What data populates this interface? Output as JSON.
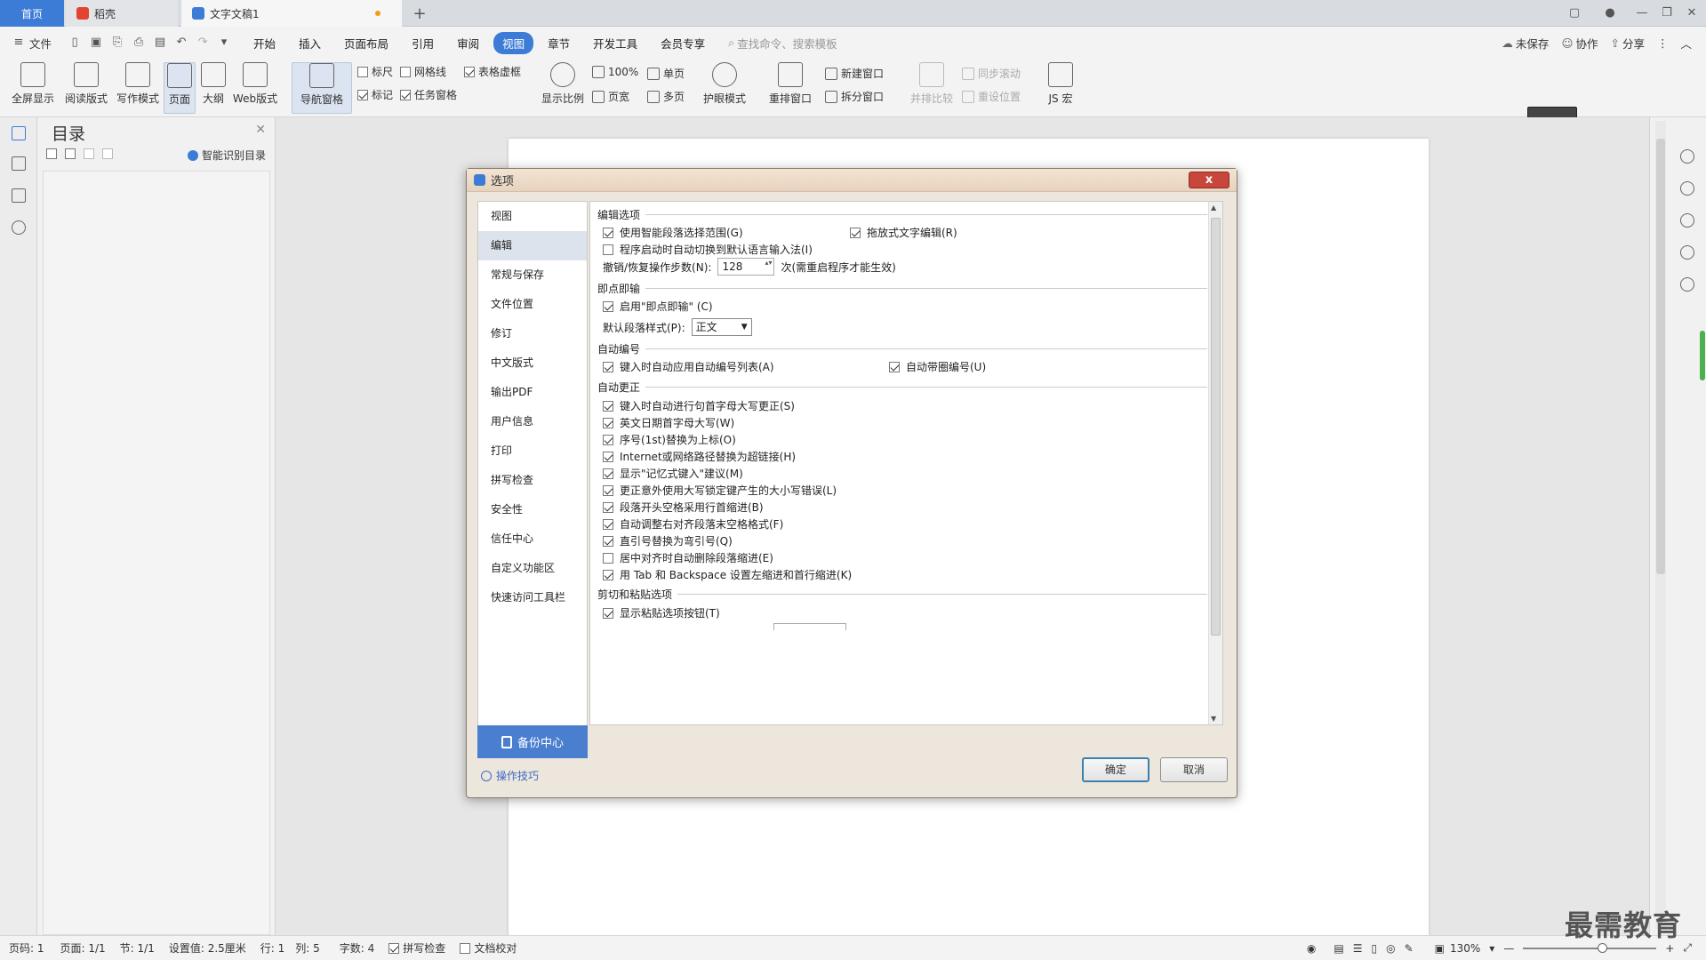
{
  "tabs": {
    "home": "首页",
    "daoke": "稻壳",
    "document": "文字文稿1",
    "new_tab": "+"
  },
  "menubar": {
    "file": "文件",
    "items": [
      "开始",
      "插入",
      "页面布局",
      "引用",
      "审阅",
      "视图",
      "章节",
      "开发工具",
      "会员专享"
    ],
    "active": "视图",
    "search_placeholder": "查找命令、搜索模板",
    "unsaved": "未保存",
    "collab": "协作",
    "share": "分享"
  },
  "ribbon": {
    "fullscreen": "全屏显示",
    "reading": "阅读版式",
    "writing": "写作模式",
    "page": "页面",
    "outline": "大纲",
    "web": "Web版式",
    "nav_pane": "导航窗格",
    "ruler": "标尺",
    "gridlines": "网格线",
    "table_gridlines": "表格虚框",
    "marks": "标记",
    "task_pane": "任务窗格",
    "zoom": "显示比例",
    "zoom_100": "100%",
    "single_page": "单页",
    "page_width": "页宽",
    "multi_page": "多页",
    "eye_mode": "护眼模式",
    "arrange_window": "重排窗口",
    "new_window": "新建窗口",
    "split_window": "拆分窗口",
    "side_by_side": "并排比较",
    "sync_scroll": "同步滚动",
    "reset_position": "重设位置",
    "js_macro": "JS 宏"
  },
  "left_panel": {
    "title": "目录",
    "smart_toc": "智能识别目录"
  },
  "dialog": {
    "title": "选项",
    "close": "x",
    "nav": [
      "视图",
      "编辑",
      "常规与保存",
      "文件位置",
      "修订",
      "中文版式",
      "输出PDF",
      "用户信息",
      "打印",
      "拼写检查",
      "安全性",
      "信任中心",
      "自定义功能区",
      "快速访问工具栏"
    ],
    "nav_selected": "编辑",
    "backup_center": "备份中心",
    "tips": "操作技巧",
    "ok": "确定",
    "cancel": "取消",
    "sections": {
      "edit_options": "编辑选项",
      "click_type": "即点即输",
      "auto_numbering": "自动编号",
      "auto_correct": "自动更正",
      "cut_paste": "剪切和粘贴选项"
    },
    "options": {
      "smart_para": "使用智能段落选择范围(G)",
      "drag_drop": "拖放式文字编辑(R)",
      "auto_ime": "程序启动时自动切换到默认语言输入法(I)",
      "undo_label": "撤销/恢复操作步数(N):",
      "undo_value": "128",
      "undo_note": "次(需重启程序才能生效)",
      "enable_click_type": "启用\"即点即输\" (C)",
      "default_style_label": "默认段落样式(P):",
      "default_style_value": "正文",
      "auto_list": "键入时自动应用自动编号列表(A)",
      "auto_circle": "自动带圈编号(U)",
      "capitalize_first": "键入时自动进行句首字母大写更正(S)",
      "capitalize_dates": "英文日期首字母大写(W)",
      "ordinals": "序号(1st)替换为上标(O)",
      "hyperlinks": "Internet或网络路径替换为超链接(H)",
      "memory_type": "显示\"记忆式键入\"建议(M)",
      "caps_lock": "更正意外使用大写锁定键产生的大小写错误(L)",
      "first_indent": "段落开头空格采用行首缩进(B)",
      "trailing_space": "自动调整右对齐段落末空格格式(F)",
      "smart_quotes": "直引号替换为弯引号(Q)",
      "center_delete": "居中对齐时自动删除段落缩进(E)",
      "tab_backspace": "用 Tab 和 Backspace 设置左缩进和首行缩进(K)",
      "paste_button": "显示粘贴选项按钮(T)"
    }
  },
  "status": {
    "page_num": "页码: 1",
    "pages": "页面: 1/1",
    "section": "节: 1/1",
    "setting": "设置值: 2.5厘米",
    "row": "行: 1",
    "col": "列: 5",
    "words": "字数: 4",
    "spell": "拼写检查",
    "proof": "文档校对",
    "zoom": "130%"
  },
  "watermark": "最需教育",
  "colors": {
    "accent": "#3d7cd6",
    "dialog_frame": "#ede6dc",
    "close_red": "#c9463d"
  }
}
